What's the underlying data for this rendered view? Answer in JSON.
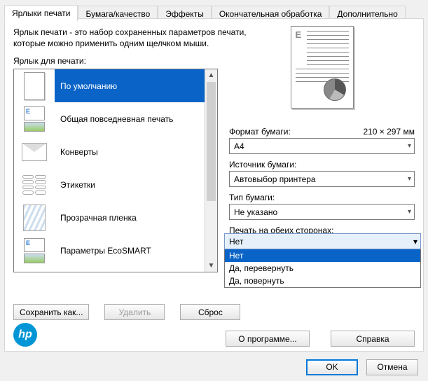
{
  "tabs": [
    "Ярлыки печати",
    "Бумага/качество",
    "Эффекты",
    "Окончательная обработка",
    "Дополнительно"
  ],
  "description": "Ярлык печати - это набор сохраненных параметров печати,\nкоторые можно применить одним щелчком мыши.",
  "shortcuts_label": "Ярлык для печати:",
  "shortcuts": [
    {
      "name": "По умолчанию"
    },
    {
      "name": "Общая повседневная печать"
    },
    {
      "name": "Конверты"
    },
    {
      "name": "Этикетки"
    },
    {
      "name": "Прозрачная пленка"
    },
    {
      "name": "Параметры EcoSMART"
    }
  ],
  "buttons": {
    "save_as": "Сохранить как...",
    "delete": "Удалить",
    "reset": "Сброс",
    "about": "О программе...",
    "help": "Справка",
    "ok": "OK",
    "cancel": "Отмена"
  },
  "paper_size": {
    "label": "Формат бумаги:",
    "dim": "210 × 297 мм",
    "value": "A4"
  },
  "paper_source": {
    "label": "Источник бумаги:",
    "value": "Автовыбор принтера"
  },
  "paper_type": {
    "label": "Тип бумаги:",
    "value": "Не указано"
  },
  "duplex": {
    "label": "Печать на обеих сторонах:",
    "value": "Нет",
    "options": [
      "Нет",
      "Да, перевернуть",
      "Да, повернуть"
    ]
  },
  "hp": "hp",
  "preview_e": "E"
}
